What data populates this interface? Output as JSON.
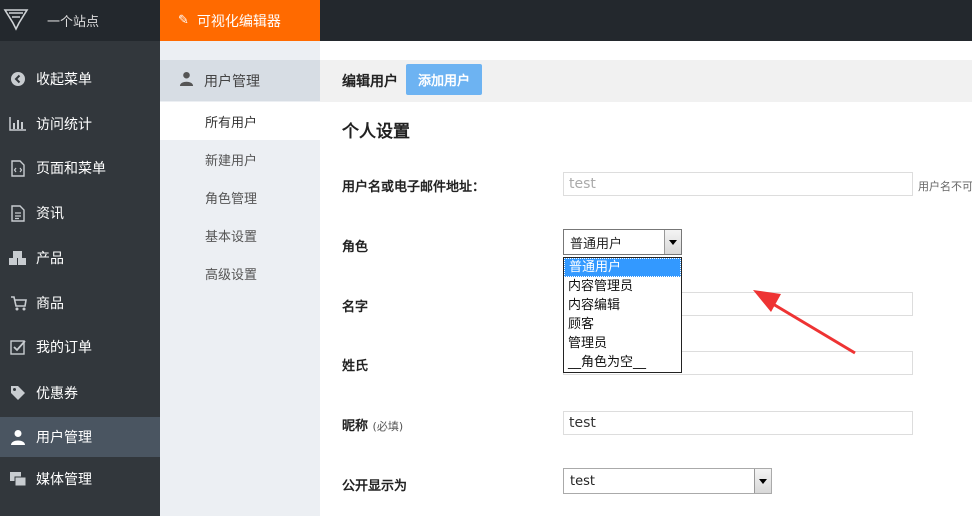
{
  "topbar": {
    "site_name": "一个站点",
    "editor_label": "可视化编辑器"
  },
  "sidebar": {
    "items": [
      {
        "label": "收起菜单",
        "icon": "collapse-icon"
      },
      {
        "label": "访问统计",
        "icon": "bar-chart-icon"
      },
      {
        "label": "页面和菜单",
        "icon": "page-icon"
      },
      {
        "label": "资讯",
        "icon": "document-icon"
      },
      {
        "label": "产品",
        "icon": "cubes-icon"
      },
      {
        "label": "商品",
        "icon": "cart-icon"
      },
      {
        "label": "我的订单",
        "icon": "checkbox-icon"
      },
      {
        "label": "优惠券",
        "icon": "tag-icon"
      },
      {
        "label": "用户管理",
        "icon": "user-icon"
      },
      {
        "label": "媒体管理",
        "icon": "media-icon"
      }
    ]
  },
  "subnav": {
    "header": "用户管理",
    "items": [
      "所有用户",
      "新建用户",
      "角色管理",
      "基本设置",
      "高级设置"
    ]
  },
  "content": {
    "title": "编辑用户",
    "add_button": "添加用户",
    "section_title": "个人设置"
  },
  "form": {
    "username_label": "用户名或电子邮件地址：",
    "username_value": "test",
    "username_hint": "用户名不可",
    "role_label": "角色",
    "role_selected": "普通用户",
    "role_options": [
      "普通用户",
      "内容管理员",
      "内容编辑",
      "顾客",
      "管理员",
      "__角色为空__"
    ],
    "firstname_label": "名字",
    "lastname_label": "姓氏",
    "nickname_label": "昵称",
    "nickname_hint": "(必填)",
    "nickname_value": "test",
    "display_label": "公开显示为",
    "display_value": "test"
  },
  "colors": {
    "topbar": "#23282d",
    "sidebar": "#32373c",
    "editor_accent": "#ff6a00",
    "add_button": "#6db3f2",
    "annotation_arrow": "#ee3333"
  }
}
